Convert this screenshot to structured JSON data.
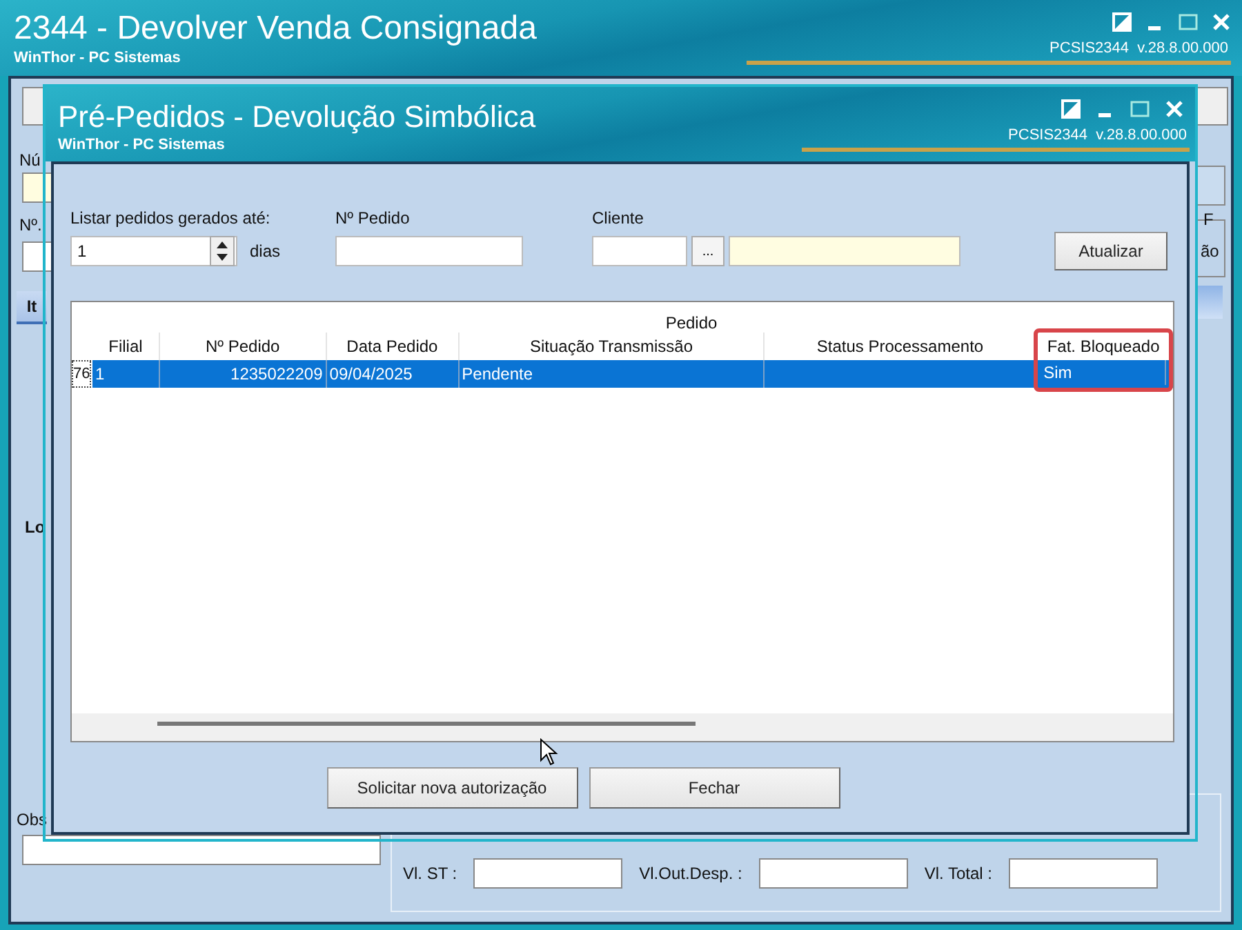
{
  "main_window": {
    "title": "2344 - Devolver Venda Consignada",
    "subtitle": "WinThor - PC Sistemas",
    "version": "PCSIS2344  v.28.8.00.000"
  },
  "background_form": {
    "fragments": [
      "Nú",
      "Nº.",
      "It",
      "Lo",
      "Obs",
      "F",
      "ão"
    ],
    "totals": [
      {
        "label": "Vl. ST :"
      },
      {
        "label": "Vl.Out.Desp. :"
      },
      {
        "label": "Vl. Total :"
      }
    ]
  },
  "dialog": {
    "title": "Pré-Pedidos - Devolução Simbólica",
    "subtitle": "WinThor - PC Sistemas",
    "version": "PCSIS2344  v.28.8.00.000",
    "filters": {
      "days_label": "Listar pedidos gerados até:",
      "days_value": "1",
      "days_unit": "dias",
      "order_label": "Nº Pedido",
      "client_label": "Cliente",
      "lookup_button": "...",
      "refresh_button": "Atualizar"
    },
    "table": {
      "group_header": "Pedido",
      "columns": [
        {
          "label": "Filial",
          "highlighted": false
        },
        {
          "label": "Nº Pedido",
          "highlighted": false
        },
        {
          "label": "Data Pedido",
          "highlighted": false
        },
        {
          "label": "Situação Transmissão",
          "highlighted": false
        },
        {
          "label": "Status Processamento",
          "highlighted": false
        },
        {
          "label": "Fat. Bloqueado",
          "highlighted": true
        }
      ],
      "rows": [
        {
          "indicator": "76",
          "selected": true,
          "cells": [
            "1",
            "1235022209",
            "09/04/2025",
            "Pendente",
            "",
            "Sim"
          ]
        }
      ]
    },
    "buttons": [
      "Solicitar nova autorização",
      "Fechar"
    ]
  }
}
